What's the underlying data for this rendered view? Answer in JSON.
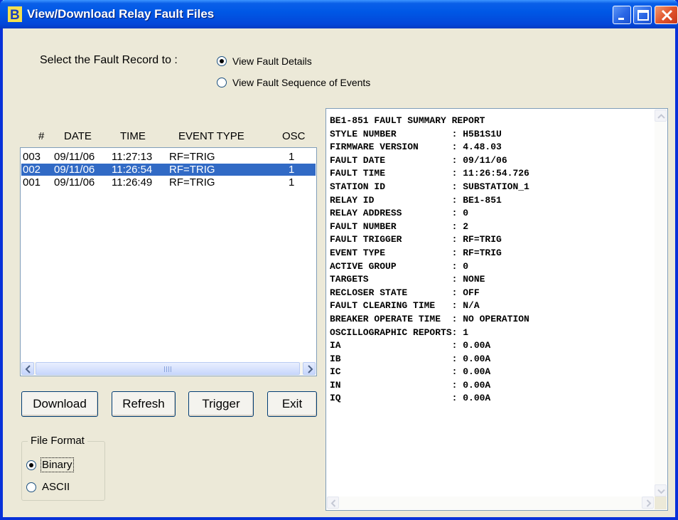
{
  "window": {
    "title": "View/Download Relay Fault Files",
    "icon_letter": "B"
  },
  "select_record": {
    "label": "Select the Fault Record to :",
    "options": [
      "View Fault Details",
      "View Fault Sequence of Events"
    ],
    "selected": "View Fault Details"
  },
  "fault_list": {
    "headers": [
      "#",
      "DATE",
      "TIME",
      "EVENT TYPE",
      "OSC"
    ],
    "rows": [
      [
        "003",
        "09/11/06",
        "11:27:13",
        "RF=TRIG",
        "1"
      ],
      [
        "002",
        "09/11/06",
        "11:26:54",
        "RF=TRIG",
        "1"
      ],
      [
        "001",
        "09/11/06",
        "11:26:49",
        "RF=TRIG",
        "1"
      ]
    ],
    "selected_index": 1
  },
  "buttons": {
    "download": "Download",
    "refresh": "Refresh",
    "trigger": "Trigger",
    "exit": "Exit"
  },
  "file_format": {
    "legend": "File Format",
    "options": [
      "Binary",
      "ASCII"
    ],
    "selected": "Binary"
  },
  "report": {
    "lines": [
      "BE1-851 FAULT SUMMARY REPORT",
      "STYLE NUMBER          : H5B1S1U",
      "FIRMWARE VERSION      : 4.48.03",
      "FAULT DATE            : 09/11/06",
      "FAULT TIME            : 11:26:54.726",
      "STATION ID            : SUBSTATION_1",
      "RELAY ID              : BE1-851",
      "RELAY ADDRESS         : 0",
      "FAULT NUMBER          : 2",
      "FAULT TRIGGER         : RF=TRIG",
      "EVENT TYPE            : RF=TRIG",
      "ACTIVE GROUP          : 0",
      "TARGETS               : NONE",
      "RECLOSER STATE        : OFF",
      "FAULT CLEARING TIME   : N/A",
      "BREAKER OPERATE TIME  : NO OPERATION",
      "OSCILLOGRAPHIC REPORTS: 1",
      "IA                    : 0.00A",
      "IB                    : 0.00A",
      "IC                    : 0.00A",
      "IN                    : 0.00A",
      "IQ                    : 0.00A"
    ]
  },
  "colors": {
    "titlebar": "#0058e6",
    "selection": "#316ac5",
    "window_bg": "#ece9d8",
    "close_button": "#e2562d"
  }
}
